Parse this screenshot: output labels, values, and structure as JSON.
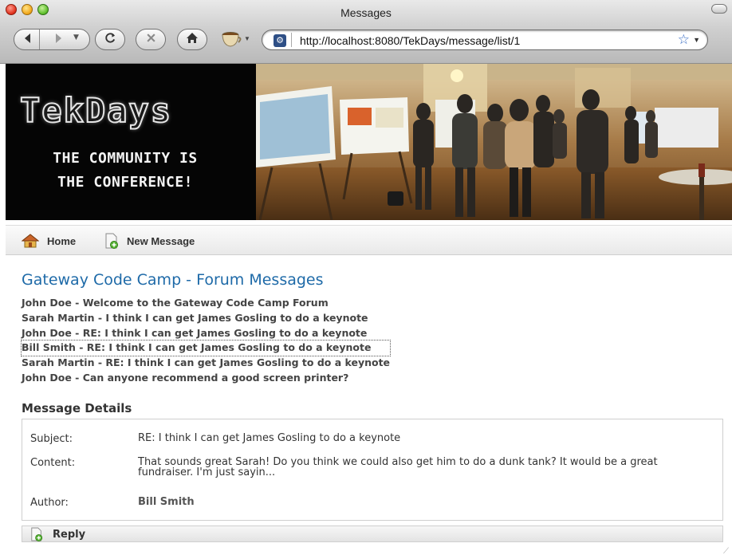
{
  "browser": {
    "window_title": "Messages",
    "url": "http://localhost:8080/TekDays/message/list/1",
    "icons": [
      "back-icon",
      "forward-icon",
      "history-dropdown-icon",
      "reload-icon",
      "stop-icon",
      "home-icon",
      "bookmarks-cup-icon",
      "favicon-icon",
      "star-bookmark-icon",
      "url-dropdown-icon"
    ]
  },
  "banner": {
    "logo": "TekDays",
    "tagline_line1": "THE COMMUNITY IS",
    "tagline_line2": "THE CONFERENCE!"
  },
  "nav": {
    "home_label": "Home",
    "new_message_label": "New Message"
  },
  "page": {
    "title": "Gateway Code Camp - Forum Messages",
    "messages": [
      "John Doe - Welcome to the Gateway Code Camp Forum",
      "Sarah Martin - I think I can get James Gosling to do a keynote",
      "John Doe - RE: I think I can get James Gosling to do a keynote",
      "Bill Smith - RE: I think I can get James Gosling to do a keynote",
      "Sarah Martin - RE: I think I can get James Gosling to do a keynote",
      "John Doe - Can anyone recommend a good screen printer?"
    ],
    "selected_message_index": 3
  },
  "details": {
    "heading": "Message Details",
    "subject_label": "Subject:",
    "subject_value": "RE: I think I can get James Gosling to do a keynote",
    "content_label": "Content:",
    "content_value": "That sounds great Sarah! Do you think we could also get him to do a dunk tank? It would be a great fundraiser. I'm just sayin...",
    "author_label": "Author:",
    "author_value": "Bill Smith"
  },
  "actions": {
    "reply_label": "Reply"
  },
  "colors": {
    "page_title": "#1e6aa8",
    "banner_bg": "#050505",
    "accent_blue": "#3a6ec5"
  }
}
